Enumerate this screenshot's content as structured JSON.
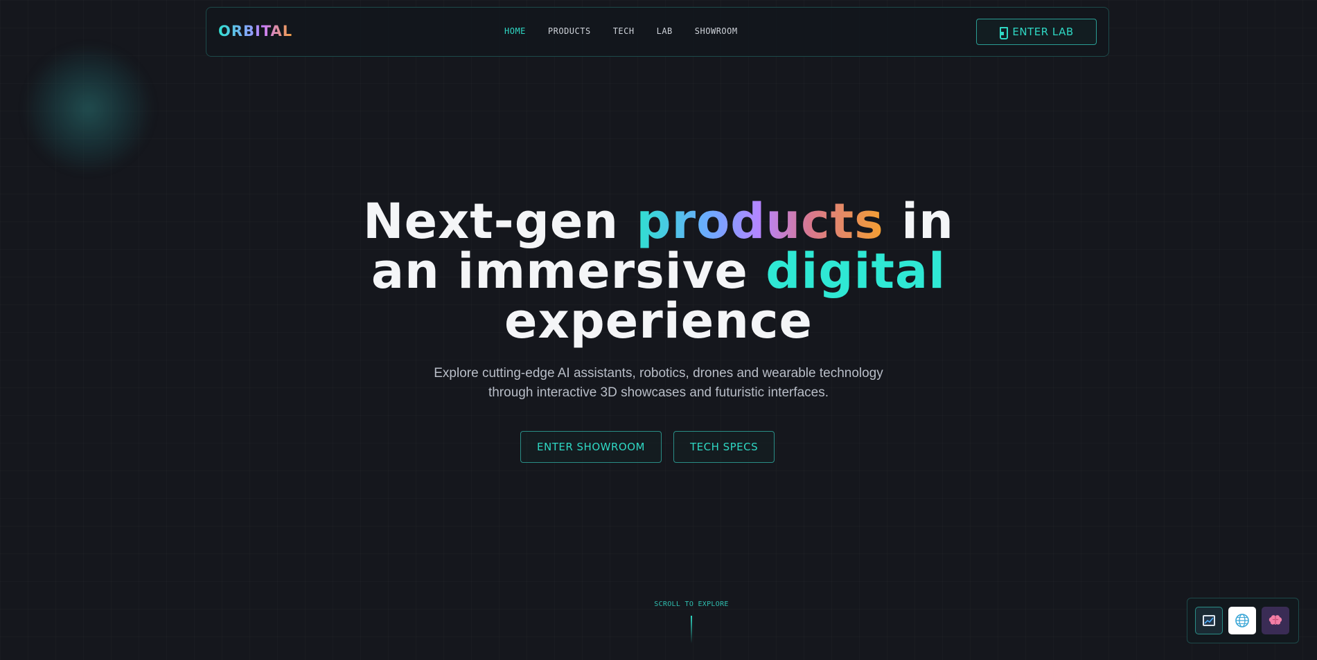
{
  "brand": {
    "logo": "ORBITAL"
  },
  "nav": {
    "links": [
      {
        "label": "HOME",
        "active": true
      },
      {
        "label": "PRODUCTS",
        "active": false
      },
      {
        "label": "TECH",
        "active": false
      },
      {
        "label": "LAB",
        "active": false
      },
      {
        "label": "SHOWROOM",
        "active": false
      }
    ],
    "enter_lab": {
      "label": "ENTER LAB",
      "icon": "flask-icon"
    }
  },
  "hero": {
    "title_part1": "Next-gen ",
    "title_highlight1": "products",
    "title_part2": " in",
    "title_part3": "an immersive ",
    "title_highlight2": "digital",
    "title_part4": "experience",
    "subtitle_line1": "Explore cutting-edge AI assistants, robotics, drones and wearable technology",
    "subtitle_line2": "through interactive 3D showcases and futuristic interfaces.",
    "cta_primary": "ENTER SHOWROOM",
    "cta_secondary": "TECH SPECS"
  },
  "scroll_hint": "SCROLL TO EXPLORE",
  "dock": {
    "items": [
      {
        "icon": "chart-icon"
      },
      {
        "icon": "globe-icon"
      },
      {
        "icon": "brain-icon"
      }
    ]
  },
  "colors": {
    "accent": "#2fd8c4",
    "background": "#15171d",
    "gradient_start": "#2fe0d0",
    "gradient_mid": "#b685ff",
    "gradient_end": "#f5a030"
  }
}
